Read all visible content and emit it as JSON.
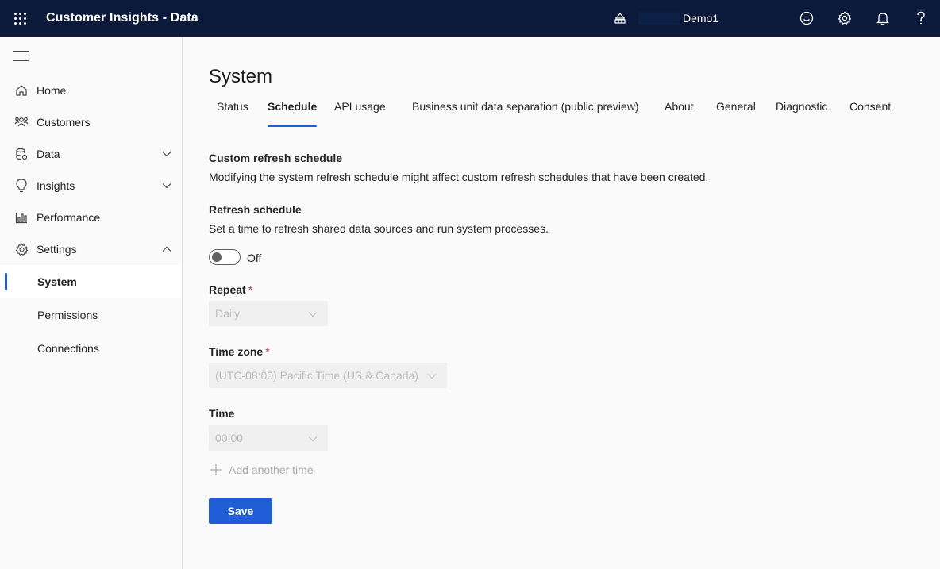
{
  "topbar": {
    "app_title": "Customer Insights - Data",
    "environment_name": "Demo1",
    "icons": [
      "waffle-icon",
      "environment-icon",
      "feedback-smiley-icon",
      "settings-gear-icon",
      "notification-bell-icon",
      "help-question-icon"
    ]
  },
  "sidebar": {
    "items": [
      {
        "label": "Home",
        "icon": "home-icon"
      },
      {
        "label": "Customers",
        "icon": "customers-icon"
      },
      {
        "label": "Data",
        "icon": "data-icon",
        "expanded": false
      },
      {
        "label": "Insights",
        "icon": "lightbulb-icon",
        "expanded": false
      },
      {
        "label": "Performance",
        "icon": "chart-icon"
      },
      {
        "label": "Settings",
        "icon": "gear-icon",
        "expanded": true
      }
    ],
    "sub_items": [
      {
        "label": "System",
        "active": true
      },
      {
        "label": "Permissions",
        "active": false
      },
      {
        "label": "Connections",
        "active": false
      }
    ]
  },
  "main": {
    "title": "System",
    "tabs": [
      {
        "label": "Status",
        "active": false
      },
      {
        "label": "Schedule",
        "active": true
      },
      {
        "label": "API usage",
        "active": false
      },
      {
        "label": "Business unit data separation (public preview)",
        "active": false
      },
      {
        "label": "About",
        "active": false
      },
      {
        "label": "General",
        "active": false
      },
      {
        "label": "Diagnostic",
        "active": false
      },
      {
        "label": "Consent",
        "active": false
      }
    ],
    "custom_refresh": {
      "heading": "Custom refresh schedule",
      "description": "Modifying the system refresh schedule might affect custom refresh schedules that have been created."
    },
    "refresh_schedule": {
      "heading": "Refresh schedule",
      "description": "Set a time to refresh shared data sources and run system processes.",
      "toggle_state": "Off"
    },
    "repeat": {
      "label": "Repeat",
      "required_mark": "*",
      "value": "Daily"
    },
    "time_zone": {
      "label": "Time zone",
      "required_mark": "*",
      "value": "(UTC-08:00) Pacific Time (US & Canada)"
    },
    "time": {
      "label": "Time",
      "value": "00:00"
    },
    "add_time_label": "Add another time",
    "save_label": "Save"
  },
  "colors": {
    "topbar_bg": "#0b1a3a",
    "accent": "#1f5ed6",
    "required": "#c4314b"
  }
}
